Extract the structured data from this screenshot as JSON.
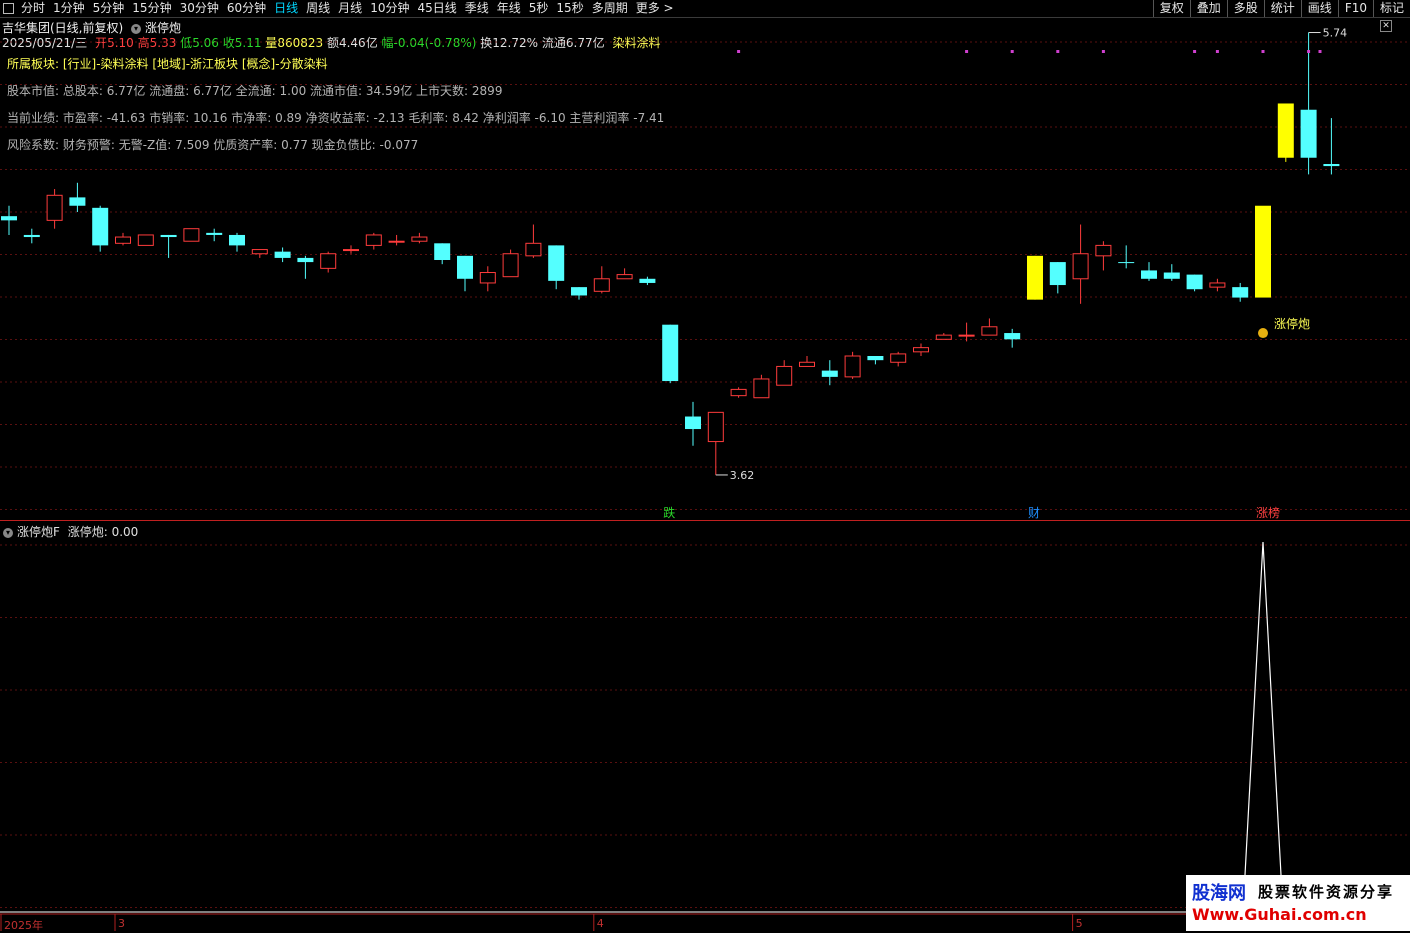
{
  "toolbar": {
    "periods": [
      "分时",
      "1分钟",
      "5分钟",
      "15分钟",
      "30分钟",
      "60分钟",
      "日线",
      "周线",
      "月线",
      "10分钟",
      "45日线",
      "季线",
      "年线",
      "5秒",
      "15秒",
      "多周期",
      "更多 >"
    ],
    "active_index": 6,
    "right_buttons": [
      "复权",
      "叠加",
      "多股",
      "统计",
      "画线",
      "F10",
      "标记"
    ]
  },
  "header": {
    "stock_title": "吉华集团(日线,前复权)",
    "indicator_name": "涨停炮",
    "close_icon": "close-x-icon",
    "date": "2025/05/21/三",
    "open_label": "开",
    "open": "5.10",
    "high_label": "高",
    "high": "5.33",
    "low_label": "低",
    "low": "5.06",
    "close_label": "收",
    "close": "5.11",
    "vol_label": "量",
    "vol": "860823",
    "amount_label": "额",
    "amount": "4.46亿",
    "change_label": "幅",
    "change": "-0.04(-0.78%)",
    "turnover_label": "换",
    "turnover": "12.72%",
    "float_label": "流通",
    "float": "6.77亿",
    "sector": "染料涂料"
  },
  "fin": {
    "row0": "所属板块: [行业]-染料涂料 [地域]-浙江板块 [概念]-分散染料",
    "row1": "股本市值: 总股本: 6.77亿 流通盘: 6.77亿 全流通: 1.00 流通市值: 34.59亿 上市天数: 2899",
    "row2": "当前业绩: 市盈率: -41.63 市销率: 10.16 市净率: 0.89 净资收益率: -2.13 毛利率: 8.42 净利润率 -6.10 主营利润率 -7.41",
    "row3": "风险系数: 财务预警: 无警-Z值: 7.509 优质资产率: 0.77 现金负债比: -0.077"
  },
  "chart_data": {
    "type": "candlestick",
    "price_range": [
      3.5,
      5.8
    ],
    "candles": [
      {
        "o": 4.86,
        "h": 4.91,
        "l": 4.77,
        "c": 4.84,
        "up": false
      },
      {
        "o": 4.76,
        "h": 4.8,
        "l": 4.73,
        "c": 4.77,
        "up": false
      },
      {
        "o": 4.84,
        "h": 4.99,
        "l": 4.8,
        "c": 4.96,
        "up": true
      },
      {
        "o": 4.95,
        "h": 5.02,
        "l": 4.88,
        "c": 4.91,
        "up": false
      },
      {
        "o": 4.9,
        "h": 4.91,
        "l": 4.69,
        "c": 4.72,
        "up": false
      },
      {
        "o": 4.73,
        "h": 4.78,
        "l": 4.72,
        "c": 4.76,
        "up": true
      },
      {
        "o": 4.72,
        "h": 4.77,
        "l": 4.72,
        "c": 4.77,
        "up": true
      },
      {
        "o": 4.77,
        "h": 4.77,
        "l": 4.66,
        "c": 4.76,
        "up": false
      },
      {
        "o": 4.74,
        "h": 4.8,
        "l": 4.74,
        "c": 4.8,
        "up": true
      },
      {
        "o": 4.78,
        "h": 4.8,
        "l": 4.74,
        "c": 4.77,
        "up": false
      },
      {
        "o": 4.77,
        "h": 4.78,
        "l": 4.69,
        "c": 4.72,
        "up": false
      },
      {
        "o": 4.7,
        "h": 4.7,
        "l": 4.66,
        "c": 4.68,
        "up": true
      },
      {
        "o": 4.69,
        "h": 4.71,
        "l": 4.64,
        "c": 4.66,
        "up": false
      },
      {
        "o": 4.66,
        "h": 4.67,
        "l": 4.56,
        "c": 4.64,
        "up": false
      },
      {
        "o": 4.61,
        "h": 4.69,
        "l": 4.59,
        "c": 4.68,
        "up": true
      },
      {
        "o": 4.7,
        "h": 4.72,
        "l": 4.68,
        "c": 4.7,
        "up": true
      },
      {
        "o": 4.72,
        "h": 4.78,
        "l": 4.7,
        "c": 4.77,
        "up": true
      },
      {
        "o": 4.74,
        "h": 4.77,
        "l": 4.72,
        "c": 4.74,
        "up": true
      },
      {
        "o": 4.74,
        "h": 4.78,
        "l": 4.73,
        "c": 4.76,
        "up": true
      },
      {
        "o": 4.73,
        "h": 4.73,
        "l": 4.63,
        "c": 4.65,
        "up": false
      },
      {
        "o": 4.67,
        "h": 4.67,
        "l": 4.5,
        "c": 4.56,
        "up": false
      },
      {
        "o": 4.54,
        "h": 4.62,
        "l": 4.5,
        "c": 4.59,
        "up": true
      },
      {
        "o": 4.57,
        "h": 4.7,
        "l": 4.57,
        "c": 4.68,
        "up": true
      },
      {
        "o": 4.67,
        "h": 4.82,
        "l": 4.66,
        "c": 4.73,
        "up": true
      },
      {
        "o": 4.72,
        "h": 4.72,
        "l": 4.51,
        "c": 4.55,
        "up": false
      },
      {
        "o": 4.52,
        "h": 4.52,
        "l": 4.46,
        "c": 4.48,
        "up": false
      },
      {
        "o": 4.5,
        "h": 4.62,
        "l": 4.49,
        "c": 4.56,
        "up": true
      },
      {
        "o": 4.56,
        "h": 4.61,
        "l": 4.56,
        "c": 4.58,
        "up": true
      },
      {
        "o": 4.56,
        "h": 4.57,
        "l": 4.53,
        "c": 4.54,
        "up": false
      },
      {
        "o": 4.34,
        "h": 4.34,
        "l": 4.06,
        "c": 4.07,
        "up": false
      },
      {
        "o": 3.9,
        "h": 3.97,
        "l": 3.76,
        "c": 3.84,
        "up": false
      },
      {
        "o": 3.78,
        "h": 3.92,
        "l": 3.62,
        "c": 3.92,
        "up": true
      },
      {
        "o": 4.0,
        "h": 4.04,
        "l": 3.99,
        "c": 4.03,
        "up": true
      },
      {
        "o": 3.99,
        "h": 4.1,
        "l": 3.99,
        "c": 4.08,
        "up": true
      },
      {
        "o": 4.05,
        "h": 4.17,
        "l": 4.05,
        "c": 4.14,
        "up": true
      },
      {
        "o": 4.14,
        "h": 4.19,
        "l": 4.14,
        "c": 4.16,
        "up": true
      },
      {
        "o": 4.12,
        "h": 4.17,
        "l": 4.05,
        "c": 4.09,
        "up": false
      },
      {
        "o": 4.09,
        "h": 4.21,
        "l": 4.08,
        "c": 4.19,
        "up": true
      },
      {
        "o": 4.19,
        "h": 4.19,
        "l": 4.15,
        "c": 4.17,
        "up": false
      },
      {
        "o": 4.16,
        "h": 4.21,
        "l": 4.14,
        "c": 4.2,
        "up": true
      },
      {
        "o": 4.21,
        "h": 4.25,
        "l": 4.19,
        "c": 4.23,
        "up": true
      },
      {
        "o": 4.27,
        "h": 4.3,
        "l": 4.27,
        "c": 4.29,
        "up": true
      },
      {
        "o": 4.29,
        "h": 4.35,
        "l": 4.26,
        "c": 4.29,
        "up": true
      },
      {
        "o": 4.29,
        "h": 4.37,
        "l": 4.29,
        "c": 4.33,
        "up": true
      },
      {
        "o": 4.3,
        "h": 4.32,
        "l": 4.23,
        "c": 4.27,
        "up": false
      },
      {
        "o": 4.46,
        "h": 4.67,
        "l": 4.46,
        "c": 4.67,
        "up": true,
        "color": "#ffff00"
      },
      {
        "o": 4.64,
        "h": 4.64,
        "l": 4.49,
        "c": 4.53,
        "up": false
      },
      {
        "o": 4.56,
        "h": 4.82,
        "l": 4.44,
        "c": 4.68,
        "up": true
      },
      {
        "o": 4.67,
        "h": 4.74,
        "l": 4.6,
        "c": 4.72,
        "up": true
      },
      {
        "o": 4.64,
        "h": 4.72,
        "l": 4.61,
        "c": 4.64,
        "up": false
      },
      {
        "o": 4.6,
        "h": 4.64,
        "l": 4.55,
        "c": 4.56,
        "up": false
      },
      {
        "o": 4.59,
        "h": 4.63,
        "l": 4.55,
        "c": 4.56,
        "up": false
      },
      {
        "o": 4.58,
        "h": 4.58,
        "l": 4.5,
        "c": 4.51,
        "up": false
      },
      {
        "o": 4.54,
        "h": 4.56,
        "l": 4.5,
        "c": 4.52,
        "up": true
      },
      {
        "o": 4.52,
        "h": 4.54,
        "l": 4.45,
        "c": 4.47,
        "up": false
      },
      {
        "o": 4.47,
        "h": 4.47,
        "l": 4.47,
        "c": 4.91,
        "up": true,
        "color": "#ffff00"
      },
      {
        "o": 5.14,
        "h": 5.39,
        "l": 5.12,
        "c": 5.4,
        "up": true,
        "color": "#ffff00"
      },
      {
        "o": 5.37,
        "h": 5.74,
        "l": 5.06,
        "c": 5.14,
        "up": false
      },
      {
        "o": 5.1,
        "h": 5.33,
        "l": 5.06,
        "c": 5.11,
        "up": false
      }
    ],
    "annotations": {
      "high_label": "5.74",
      "low_label": "3.62",
      "signal_label": "涨停炮",
      "signal_icon": "money-bag-icon"
    },
    "markers": [
      {
        "label": "跌",
        "index": 29,
        "color": "#2bd92b"
      },
      {
        "label": "财",
        "index": 45,
        "color": "#1e8fff"
      },
      {
        "label": "涨榜",
        "index": 55,
        "color": "#ff4040"
      }
    ],
    "purple_dot_indices": [
      32,
      42,
      44,
      46,
      48,
      52,
      53,
      55,
      57,
      57.5
    ],
    "indicator": {
      "name": "涨停炮F",
      "value_label": "涨停炮: 0.00",
      "spike_index": 55,
      "spike_value": 1
    }
  },
  "axis": {
    "labels": [
      {
        "text": "2025年",
        "index": 0
      },
      {
        "text": "3",
        "index": 5
      },
      {
        "text": "4",
        "index": 26
      },
      {
        "text": "5",
        "index": 47
      }
    ]
  },
  "watermark": {
    "line1": "股海网",
    "line2": "股票软件资源分享",
    "line3": "Www.Guhai.com.cn"
  }
}
